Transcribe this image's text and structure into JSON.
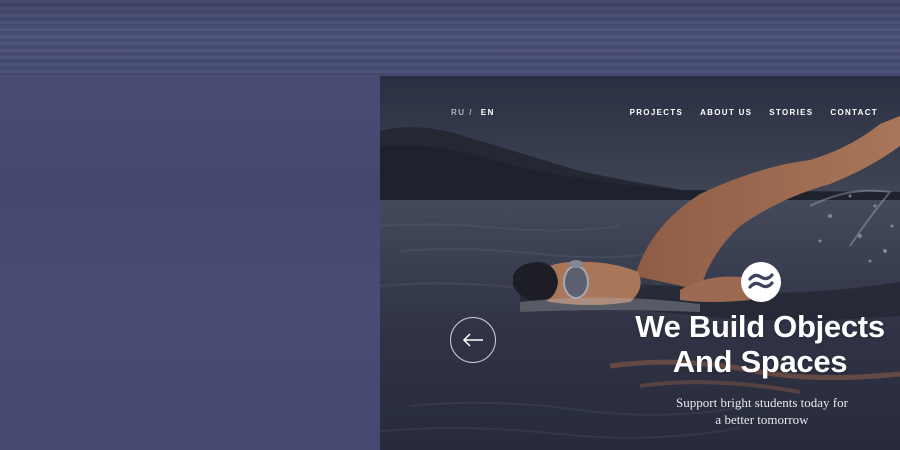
{
  "lang": {
    "inactive": "RU",
    "separator": "/",
    "active": "EN"
  },
  "nav": {
    "items": [
      {
        "label": "PROJECTS"
      },
      {
        "label": "ABOUT US"
      },
      {
        "label": "STORIES"
      },
      {
        "label": "CONTACT"
      }
    ]
  },
  "hero": {
    "headline_line1": "We Build Objects",
    "headline_line2": "And Spaces",
    "subline_line1": "Support bright students today for",
    "subline_line2": "a better tomorrow"
  },
  "icons": {
    "prev": "arrow-left-icon",
    "logo": "wave-logo-icon"
  },
  "colors": {
    "background": "#45496f",
    "text": "#ffffff",
    "muted": "#aeb3c2"
  }
}
